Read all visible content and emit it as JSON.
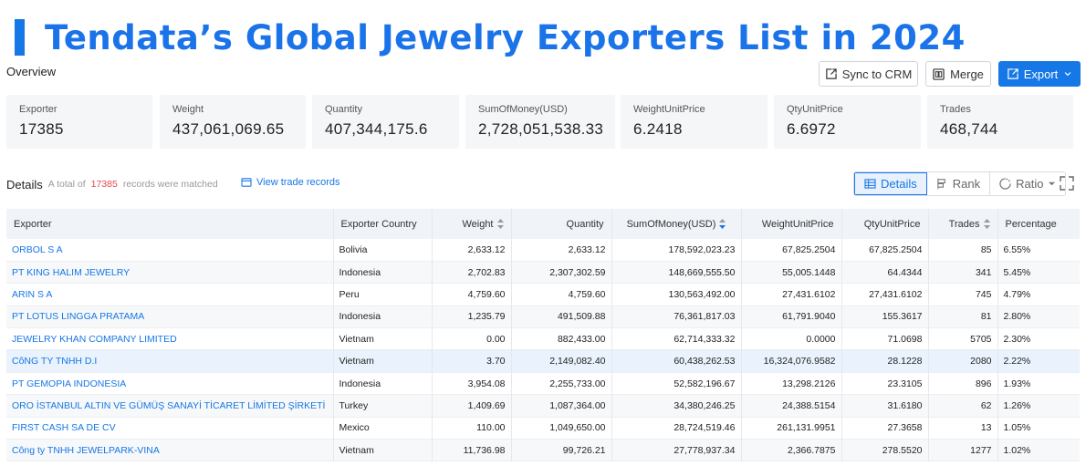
{
  "title": "Tendata’s Global Jewelry Exporters List in 2024",
  "overview_label": "Overview",
  "toolbar": {
    "sync_label": "Sync to CRM",
    "merge_label": "Merge",
    "export_label": "Export"
  },
  "cards": [
    {
      "label": "Exporter",
      "value": "17385"
    },
    {
      "label": "Weight",
      "value": "437,061,069.65"
    },
    {
      "label": "Quantity",
      "value": "407,344,175.6"
    },
    {
      "label": "SumOfMoney(USD)",
      "value": "2,728,051,538.33"
    },
    {
      "label": "WeightUnitPrice",
      "value": "6.2418"
    },
    {
      "label": "QtyUnitPrice",
      "value": "6.6972"
    },
    {
      "label": "Trades",
      "value": "468,744"
    }
  ],
  "details": {
    "title": "Details",
    "note_prefix": "A total of",
    "count": "17385",
    "note_suffix": "records were matched",
    "view_link": "View trade records",
    "views": [
      "Details",
      "Rank",
      "Ratio"
    ],
    "active_view": "Details"
  },
  "table": {
    "columns": [
      "Exporter",
      "Exporter Country",
      "Weight",
      "Quantity",
      "SumOfMoney(USD)",
      "WeightUnitPrice",
      "QtyUnitPrice",
      "Trades",
      "Percentage"
    ],
    "rows": [
      [
        "ORBOL S A",
        "Bolivia",
        "2,633.12",
        "2,633.12",
        "178,592,023.23",
        "67,825.2504",
        "67,825.2504",
        "85",
        "6.55%"
      ],
      [
        "PT KING HALIM JEWELRY",
        "Indonesia",
        "2,702.83",
        "2,307,302.59",
        "148,669,555.50",
        "55,005.1448",
        "64.4344",
        "341",
        "5.45%"
      ],
      [
        "ARIN S A",
        "Peru",
        "4,759.60",
        "4,759.60",
        "130,563,492.00",
        "27,431.6102",
        "27,431.6102",
        "745",
        "4.79%"
      ],
      [
        "PT LOTUS LINGGA PRATAMA",
        "Indonesia",
        "1,235.79",
        "491,509.88",
        "76,361,817.03",
        "61,791.9040",
        "155.3617",
        "81",
        "2.80%"
      ],
      [
        "JEWELRY KHAN COMPANY LIMITED",
        "Vietnam",
        "0.00",
        "882,433.00",
        "62,714,333.32",
        "0.0000",
        "71.0698",
        "5705",
        "2.30%"
      ],
      [
        "CôNG TY TNHH D.I",
        "Vietnam",
        "3.70",
        "2,149,082.40",
        "60,438,262.53",
        "16,324,076.9582",
        "28.1228",
        "2080",
        "2.22%"
      ],
      [
        "PT GEMOPIA INDONESIA",
        "Indonesia",
        "3,954.08",
        "2,255,733.00",
        "52,582,196.67",
        "13,298.2126",
        "23.3105",
        "896",
        "1.93%"
      ],
      [
        "ORO İSTANBUL ALTIN VE GÜMÜŞ SANAYİ TİCARET LİMİTED ŞİRKETİ",
        "Turkey",
        "1,409.69",
        "1,087,364.00",
        "34,380,246.25",
        "24,388.5154",
        "31.6180",
        "62",
        "1.26%"
      ],
      [
        "FIRST CASH SA DE CV",
        "Mexico",
        "110.00",
        "1,049,650.00",
        "28,724,519.46",
        "261,131.9951",
        "27.3658",
        "13",
        "1.05%"
      ],
      [
        "Công ty TNHH JEWELPARK-VINA",
        "Vietnam",
        "11,736.98",
        "99,726.21",
        "27,778,937.34",
        "2,366.7875",
        "278.5520",
        "1277",
        "1.02%"
      ]
    ]
  }
}
